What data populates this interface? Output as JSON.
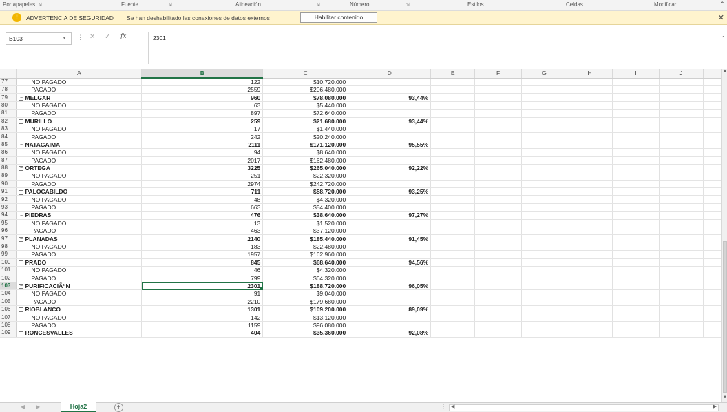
{
  "ribbon_groups": [
    {
      "label": "Portapapeles"
    },
    {
      "label": "Fuente"
    },
    {
      "label": ""
    },
    {
      "label": "Alineación"
    },
    {
      "label": ""
    },
    {
      "label": "Número"
    },
    {
      "label": ""
    },
    {
      "label": "Estilos"
    },
    {
      "label": "Celdas"
    },
    {
      "label": "Modificar"
    }
  ],
  "warning": {
    "title": "ADVERTENCIA DE SEGURIDAD",
    "message": "Se han deshabilitado las conexiones de datos externos",
    "button": "Habilitar contenido"
  },
  "formula_bar": {
    "name_box": "B103",
    "formula": "2301"
  },
  "columns": [
    "A",
    "B",
    "C",
    "D",
    "E",
    "F",
    "G",
    "H",
    "I",
    "J"
  ],
  "rows": [
    {
      "n": "77",
      "a": "NO PAGADO",
      "b": "122",
      "c": "$10.720.000",
      "d": "",
      "group": false
    },
    {
      "n": "78",
      "a": "PAGADO",
      "b": "2559",
      "c": "$206.480.000",
      "d": "",
      "group": false
    },
    {
      "n": "79",
      "a": "MELGAR",
      "b": "960",
      "c": "$78.080.000",
      "d": "93,44%",
      "group": true
    },
    {
      "n": "80",
      "a": "NO PAGADO",
      "b": "63",
      "c": "$5.440.000",
      "d": "",
      "group": false
    },
    {
      "n": "81",
      "a": "PAGADO",
      "b": "897",
      "c": "$72.640.000",
      "d": "",
      "group": false
    },
    {
      "n": "82",
      "a": "MURILLO",
      "b": "259",
      "c": "$21.680.000",
      "d": "93,44%",
      "group": true
    },
    {
      "n": "83",
      "a": "NO PAGADO",
      "b": "17",
      "c": "$1.440.000",
      "d": "",
      "group": false
    },
    {
      "n": "84",
      "a": "PAGADO",
      "b": "242",
      "c": "$20.240.000",
      "d": "",
      "group": false
    },
    {
      "n": "85",
      "a": "NATAGAIMA",
      "b": "2111",
      "c": "$171.120.000",
      "d": "95,55%",
      "group": true
    },
    {
      "n": "86",
      "a": "NO PAGADO",
      "b": "94",
      "c": "$8.640.000",
      "d": "",
      "group": false
    },
    {
      "n": "87",
      "a": "PAGADO",
      "b": "2017",
      "c": "$162.480.000",
      "d": "",
      "group": false
    },
    {
      "n": "88",
      "a": "ORTEGA",
      "b": "3225",
      "c": "$265.040.000",
      "d": "92,22%",
      "group": true
    },
    {
      "n": "89",
      "a": "NO PAGADO",
      "b": "251",
      "c": "$22.320.000",
      "d": "",
      "group": false
    },
    {
      "n": "90",
      "a": "PAGADO",
      "b": "2974",
      "c": "$242.720.000",
      "d": "",
      "group": false
    },
    {
      "n": "91",
      "a": "PALOCABILDO",
      "b": "711",
      "c": "$58.720.000",
      "d": "93,25%",
      "group": true
    },
    {
      "n": "92",
      "a": "NO PAGADO",
      "b": "48",
      "c": "$4.320.000",
      "d": "",
      "group": false
    },
    {
      "n": "93",
      "a": "PAGADO",
      "b": "663",
      "c": "$54.400.000",
      "d": "",
      "group": false
    },
    {
      "n": "94",
      "a": "PIEDRAS",
      "b": "476",
      "c": "$38.640.000",
      "d": "97,27%",
      "group": true
    },
    {
      "n": "95",
      "a": "NO PAGADO",
      "b": "13",
      "c": "$1.520.000",
      "d": "",
      "group": false
    },
    {
      "n": "96",
      "a": "PAGADO",
      "b": "463",
      "c": "$37.120.000",
      "d": "",
      "group": false
    },
    {
      "n": "97",
      "a": "PLANADAS",
      "b": "2140",
      "c": "$185.440.000",
      "d": "91,45%",
      "group": true
    },
    {
      "n": "98",
      "a": "NO PAGADO",
      "b": "183",
      "c": "$22.480.000",
      "d": "",
      "group": false
    },
    {
      "n": "99",
      "a": "PAGADO",
      "b": "1957",
      "c": "$162.960.000",
      "d": "",
      "group": false
    },
    {
      "n": "100",
      "a": "PRADO",
      "b": "845",
      "c": "$68.640.000",
      "d": "94,56%",
      "group": true
    },
    {
      "n": "101",
      "a": "NO PAGADO",
      "b": "46",
      "c": "$4.320.000",
      "d": "",
      "group": false
    },
    {
      "n": "102",
      "a": "PAGADO",
      "b": "799",
      "c": "$64.320.000",
      "d": "",
      "group": false
    },
    {
      "n": "103",
      "a": "PURIFICACIÃ“N",
      "b": "2301",
      "c": "$188.720.000",
      "d": "96,05%",
      "group": true
    },
    {
      "n": "104",
      "a": "NO PAGADO",
      "b": "91",
      "c": "$9.040.000",
      "d": "",
      "group": false
    },
    {
      "n": "105",
      "a": "PAGADO",
      "b": "2210",
      "c": "$179.680.000",
      "d": "",
      "group": false
    },
    {
      "n": "106",
      "a": "RIOBLANCO",
      "b": "1301",
      "c": "$109.200.000",
      "d": "89,09%",
      "group": true
    },
    {
      "n": "107",
      "a": "NO PAGADO",
      "b": "142",
      "c": "$13.120.000",
      "d": "",
      "group": false
    },
    {
      "n": "108",
      "a": "PAGADO",
      "b": "1159",
      "c": "$96.080.000",
      "d": "",
      "group": false
    },
    {
      "n": "109",
      "a": "RONCESVALLES",
      "b": "404",
      "c": "$35.360.000",
      "d": "92,08%",
      "group": true
    }
  ],
  "selection": {
    "row": "103",
    "col": "B"
  },
  "sheet_tab": "Hoja2",
  "add_sheet_symbol": "+",
  "accent_color": "#217346",
  "warning_color": "#fff4ce"
}
